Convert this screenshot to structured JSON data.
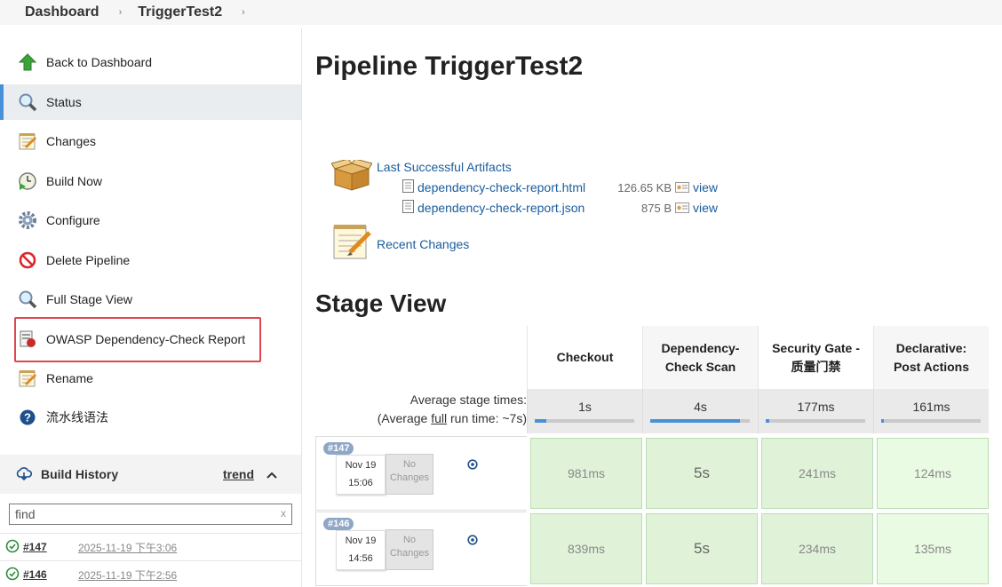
{
  "breadcrumb": {
    "items": [
      "Dashboard",
      "TriggerTest2"
    ]
  },
  "sidebar": {
    "tasks": [
      {
        "label": "Back to Dashboard",
        "icon": "up-arrow-icon"
      },
      {
        "label": "Status",
        "icon": "magnifier-icon"
      },
      {
        "label": "Changes",
        "icon": "notepad-icon"
      },
      {
        "label": "Build Now",
        "icon": "clock-play-icon"
      },
      {
        "label": "Configure",
        "icon": "gear-icon"
      },
      {
        "label": "Delete Pipeline",
        "icon": "no-entry-icon"
      },
      {
        "label": "Full Stage View",
        "icon": "magnifier-icon"
      },
      {
        "label": "OWASP Dependency-Check Report",
        "icon": "report-icon"
      },
      {
        "label": "Rename",
        "icon": "notepad-icon"
      },
      {
        "label": "流水线语法",
        "icon": "help-icon"
      }
    ],
    "build_history": {
      "title": "Build History",
      "trend": "trend",
      "find_value": "find",
      "clear": "x",
      "builds": [
        {
          "number": "#147",
          "date": "2025-11-19 下午3:06"
        },
        {
          "number": "#146",
          "date": "2025-11-19 下午2:56"
        }
      ]
    }
  },
  "main": {
    "title": "Pipeline TriggerTest2",
    "last_artifacts": "Last Successful Artifacts",
    "artifacts": [
      {
        "name": "dependency-check-report.html",
        "size": "126.65 KB",
        "view": "view"
      },
      {
        "name": "dependency-check-report.json",
        "size": "875 B",
        "view": "view"
      }
    ],
    "recent_changes": "Recent Changes",
    "stage_view_title": "Stage View",
    "stages": [
      {
        "name": "Checkout",
        "avg": "1s",
        "avg_fraction": 0.12
      },
      {
        "name": "Dependency-Check Scan",
        "avg": "4s",
        "avg_fraction": 0.9
      },
      {
        "name": "Security Gate - 质量门禁",
        "avg": "177ms",
        "avg_fraction": 0.04
      },
      {
        "name": "Declarative: Post Actions",
        "avg": "161ms",
        "avg_fraction": 0.03
      }
    ],
    "avg_label_1": "Average stage times:",
    "avg_label_2a": "(Average ",
    "avg_label_2b": "full",
    "avg_label_2c": " run time: ~7s)",
    "runs": [
      {
        "badge": "#147",
        "date": "Nov 19",
        "time": "15:06",
        "changes": "No Changes",
        "durations": [
          "981ms",
          "5s",
          "241ms",
          "124ms"
        ]
      },
      {
        "badge": "#146",
        "date": "Nov 19",
        "time": "14:56",
        "changes": "No Changes",
        "durations": [
          "839ms",
          "5s",
          "234ms",
          "135ms"
        ]
      }
    ],
    "colors": {
      "link": "#1a5c9c",
      "success_cell": "#e0f3d9",
      "highlight_border": "#e0474c"
    }
  }
}
